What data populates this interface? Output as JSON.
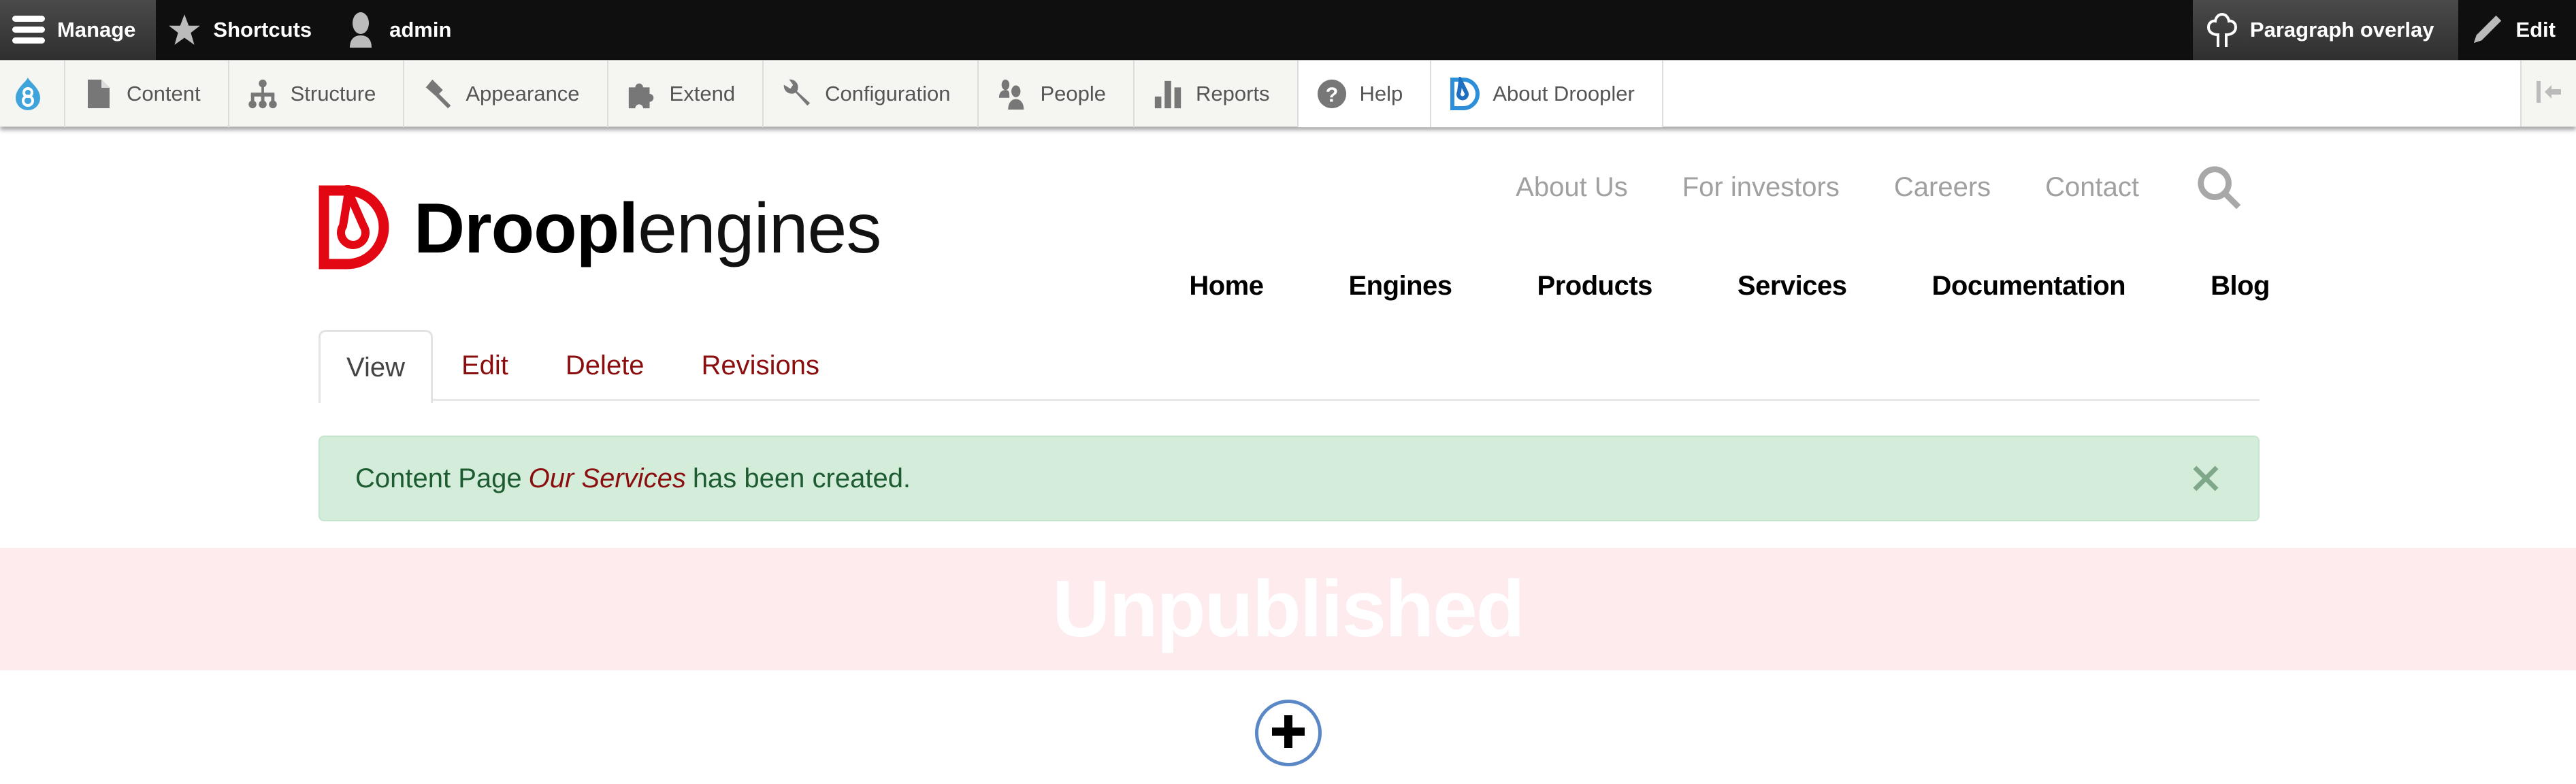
{
  "toolbar": {
    "manage_label": "Manage",
    "shortcuts_label": "Shortcuts",
    "user_label": "admin",
    "paragraph_overlay_label": "Paragraph overlay",
    "edit_label": "Edit"
  },
  "tray": {
    "items": [
      {
        "label": "Content",
        "icon": "file-icon"
      },
      {
        "label": "Structure",
        "icon": "sitemap-icon"
      },
      {
        "label": "Appearance",
        "icon": "paintbrush-icon"
      },
      {
        "label": "Extend",
        "icon": "puzzle-icon"
      },
      {
        "label": "Configuration",
        "icon": "wrench-icon"
      },
      {
        "label": "People",
        "icon": "people-icon"
      },
      {
        "label": "Reports",
        "icon": "bar-chart-icon"
      },
      {
        "label": "Help",
        "icon": "help-icon"
      },
      {
        "label": "About Droopler",
        "icon": "droopler-icon"
      }
    ]
  },
  "site": {
    "logo_bold": "Droopl",
    "logo_light": "engines",
    "top_links": [
      "About Us",
      "For investors",
      "Careers",
      "Contact"
    ],
    "main_nav": [
      "Home",
      "Engines",
      "Products",
      "Services",
      "Documentation",
      "Blog"
    ]
  },
  "tabs": [
    "View",
    "Edit",
    "Delete",
    "Revisions"
  ],
  "message": {
    "prefix": "Content Page",
    "title": "Our Services",
    "suffix": "has been created."
  },
  "status_banner": "Unpublished",
  "colors": {
    "brand_red": "#e30613",
    "link_red": "#8b0e0e",
    "success_bg": "#d4eddb",
    "unpublished_bg": "#fdebed",
    "add_ring": "#5a88c6"
  }
}
